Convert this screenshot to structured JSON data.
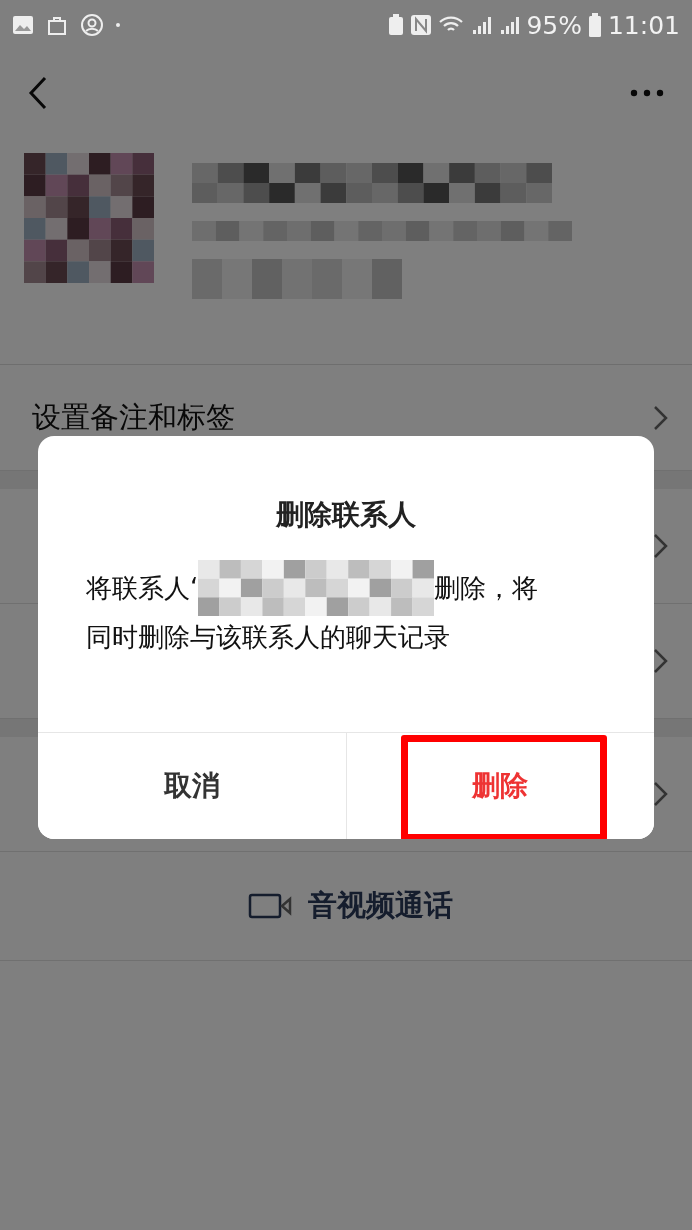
{
  "status_bar": {
    "battery": "95%",
    "time": "11:01"
  },
  "rows": [
    {
      "kind": "link",
      "label": "设置备注和标签"
    },
    {
      "kind": "hidden"
    },
    {
      "kind": "hidden"
    },
    {
      "kind": "hidden"
    },
    {
      "kind": "action",
      "label": "音视频通话"
    }
  ],
  "dialog": {
    "title": "删除联系人",
    "message_before": "将联系人‘",
    "message_after": "删除，将",
    "message_line_2": "同时删除与该联系人的聊天记录",
    "buttons": [
      {
        "label": "取消",
        "kind": "cancel",
        "highlighted": false
      },
      {
        "label": "删除",
        "kind": "danger",
        "highlighted": true
      }
    ]
  }
}
